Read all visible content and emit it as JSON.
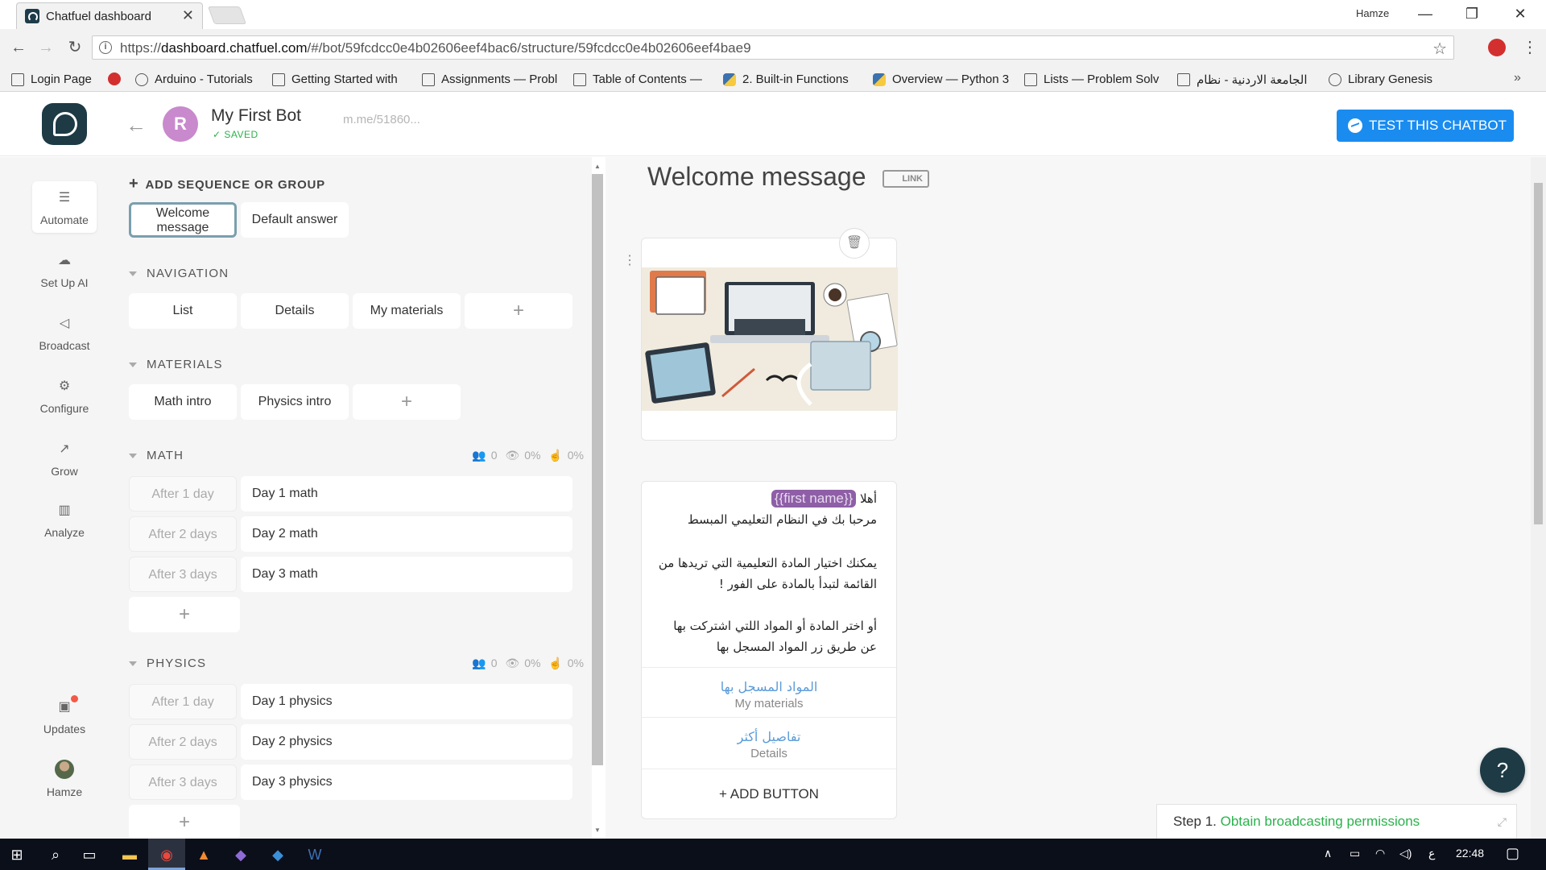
{
  "browser": {
    "tab_title": "Chatfuel dashboard",
    "tab_close": "✕",
    "window_user": "Hamze",
    "url_prefix": "https://",
    "url_host": "dashboard.chatfuel.com",
    "url_path": "/#/bot/59fcdcc0e4b02606eef4bac6/structure/59fcdcc0e4b02606eef4bae9",
    "bookmarks": [
      {
        "label": "Login Page",
        "icon": "page-icon"
      },
      {
        "label": "",
        "icon": "opera-icon"
      },
      {
        "label": "Arduino - Tutorials",
        "icon": "arduino-icon"
      },
      {
        "label": "Getting Started with",
        "icon": "book-icon"
      },
      {
        "label": "Assignments — Probl",
        "icon": "book-icon"
      },
      {
        "label": "Table of Contents —",
        "icon": "book-icon"
      },
      {
        "label": "2. Built-in Functions",
        "icon": "python-icon"
      },
      {
        "label": "Overview — Python 3",
        "icon": "python-icon"
      },
      {
        "label": "Lists — Problem Solv",
        "icon": "book-icon"
      },
      {
        "label": "الجامعة الاردنية - نظام",
        "icon": "page-icon"
      },
      {
        "label": "Library Genesis",
        "icon": "library-icon"
      }
    ]
  },
  "header": {
    "avatar_letter": "R",
    "bot_name": "My First Bot",
    "saved_label": "✓ SAVED",
    "bot_link": "m.me/51860...",
    "test_button": "TEST THIS CHATBOT"
  },
  "sidebar": {
    "items": [
      {
        "label": "Automate",
        "icon": "automate-icon",
        "glyph": "☰"
      },
      {
        "label": "Set Up AI",
        "icon": "ai-icon",
        "glyph": "☁"
      },
      {
        "label": "Broadcast",
        "icon": "megaphone-icon",
        "glyph": "📢"
      },
      {
        "label": "Configure",
        "icon": "gear-icon",
        "glyph": "⚙"
      },
      {
        "label": "Grow",
        "icon": "grow-icon",
        "glyph": "↗"
      },
      {
        "label": "Analyze",
        "icon": "chart-icon",
        "glyph": "▥"
      }
    ],
    "updates_label": "Updates",
    "user_label": "Hamze"
  },
  "structure": {
    "add_sequence": "ADD SEQUENCE OR GROUP",
    "top_cards": [
      "Welcome\nmessage",
      "Default answer"
    ],
    "groups": {
      "navigation": {
        "title": "NAVIGATION",
        "cards": [
          "List",
          "Details",
          "My materials"
        ]
      },
      "materials": {
        "title": "MATERIALS",
        "cards": [
          "Math intro",
          "Physics intro"
        ]
      },
      "math": {
        "title": "MATH",
        "stats": {
          "users": "0",
          "views": "0%",
          "clicks": "0%"
        },
        "rows": [
          {
            "delay": "After 1 day",
            "name": "Day 1 math"
          },
          {
            "delay": "After 2 days",
            "name": "Day 2 math"
          },
          {
            "delay": "After 3 days",
            "name": "Day 3 math"
          }
        ]
      },
      "physics": {
        "title": "PHYSICS",
        "stats": {
          "users": "0",
          "views": "0%",
          "clicks": "0%"
        },
        "rows": [
          {
            "delay": "After 1 day",
            "name": "Day 1 physics"
          },
          {
            "delay": "After 2 days",
            "name": "Day 2 physics"
          },
          {
            "delay": "After 3 days",
            "name": "Day 3 physics"
          }
        ]
      }
    },
    "plus": "+"
  },
  "editor": {
    "title": "Welcome message",
    "link_label": "LINK",
    "text_card": {
      "greeting": "أهلا",
      "variable": "{{first name}}",
      "lines": [
        "مرحبا بك في النظام التعليمي المبسط",
        "يمكنك اختيار المادة التعليمية التي تريدها من",
        "القائمة لتبدأ بالمادة على الفور !",
        "أو اختر المادة أو المواد اللتي اشتركت بها",
        "عن طريق زر المواد المسجل بها"
      ],
      "buttons": [
        {
          "title": "المواد المسجل بها",
          "target": "My materials"
        },
        {
          "title": "تفاصيل أكثر",
          "target": "Details"
        }
      ],
      "add_button": "+ ADD BUTTON"
    }
  },
  "onboarding": {
    "step_label": "Step 1.",
    "step_link": "Obtain broadcasting permissions"
  },
  "taskbar": {
    "time": "22:48",
    "lang": "ع"
  },
  "colors": {
    "accent_blue": "#1a8cf0",
    "saved_green": "#2bb24c",
    "brand_dark": "#1d3a45",
    "variable_purple": "#8e5fa6"
  }
}
